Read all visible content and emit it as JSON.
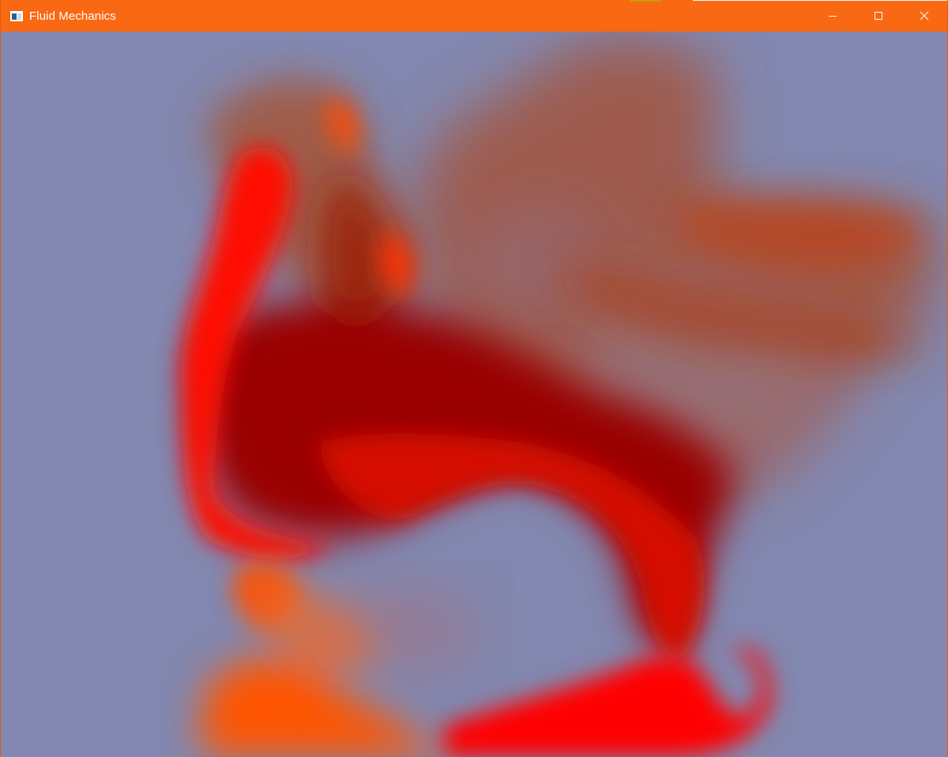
{
  "window": {
    "title": "Fluid Mechanics",
    "titlebar_color": "#f96812",
    "titlebar_text_color": "#ffffff"
  },
  "controls": {
    "minimize_icon": "minimize-icon",
    "maximize_icon": "maximize-icon",
    "close_icon": "close-icon"
  },
  "simulation": {
    "background_color": "#8288b0",
    "dye_colors": [
      "#ff0000",
      "#ff5a00",
      "#a80000",
      "#b04a1e",
      "#9e5a58"
    ]
  }
}
